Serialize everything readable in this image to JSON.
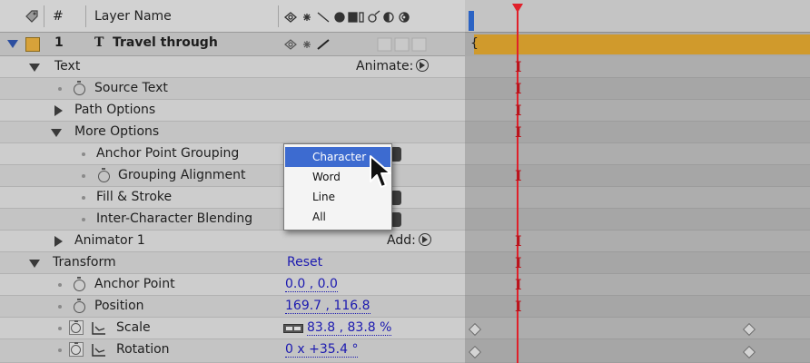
{
  "header": {
    "number_col": "#",
    "layer_name_col": "Layer Name"
  },
  "layer": {
    "number": "1",
    "type_icon": "T",
    "name": "Travel through"
  },
  "rows": {
    "text": "Text",
    "animate": "Animate:",
    "source_text": "Source Text",
    "path_options": "Path Options",
    "more_options": "More Options",
    "anchor_point_grouping": "Anchor Point Grouping",
    "grouping_alignment": "Grouping Alignment",
    "fill_stroke": "Fill & Stroke",
    "inter_char_blending": "Inter-Character Blending",
    "animator_1": "Animator 1",
    "add": "Add:",
    "transform": "Transform",
    "reset": "Reset",
    "anchor_point": "Anchor Point",
    "anchor_point_value": "0.0 , 0.0",
    "position": "Position",
    "position_value": "169.7 , 116.8",
    "scale": "Scale",
    "scale_value": "83.8 , 83.8 %",
    "rotation": "Rotation",
    "rotation_value": "0 x +35.4 °"
  },
  "dropdown": {
    "options": [
      "Character",
      "Word",
      "Line",
      "All"
    ],
    "selected": "Character"
  },
  "colors": {
    "layer_bar": "#d09a2c",
    "current_time_indicator": "#e0202a",
    "selection": "#3d6bd0",
    "value_link": "#1c1ab0"
  }
}
